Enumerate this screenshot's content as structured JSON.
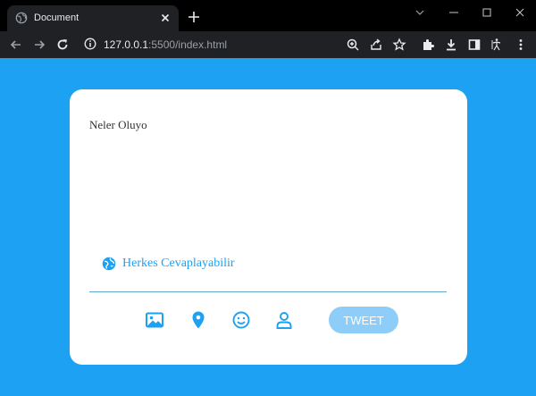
{
  "browser": {
    "tab_title": "Document",
    "url_host": "127.0.0.1",
    "url_rest": ":5500/index.html"
  },
  "composer": {
    "placeholder": "Neler Oluyo",
    "reply_setting": "Herkes Cevaplayabilir",
    "tweet_button": "TWEET",
    "actions": [
      "image-icon",
      "location-pin-icon",
      "emoji-icon",
      "user-icon"
    ]
  },
  "colors": {
    "background": "#1da1f2",
    "accent": "#1da1f2",
    "button_disabled": "#8ecdf7"
  }
}
